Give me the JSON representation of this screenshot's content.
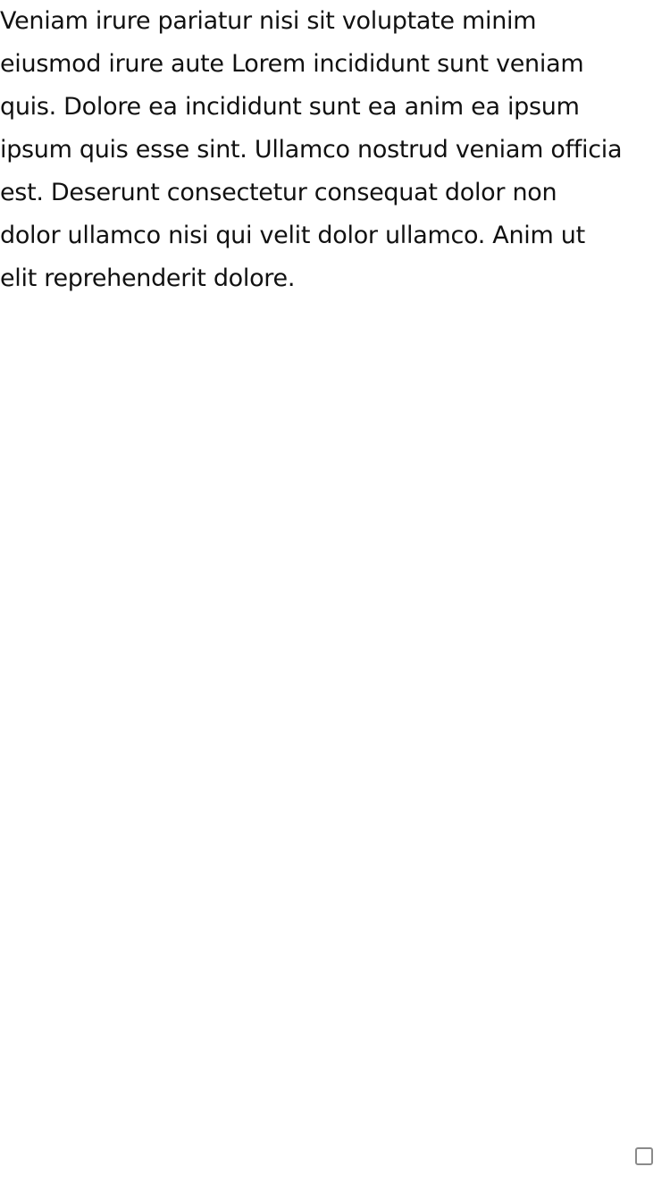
{
  "paragraph": {
    "lines": [
      "Veniam irure pariatur nisi sit voluptate minim",
      "eiusmod irure aute Lorem incididunt sunt veniam",
      "quis. Dolore ea incididunt sunt ea anim ea ipsum",
      "ipsum quis esse sint. Ullamco nostrud veniam officia",
      "est. Deserunt consectetur consequat dolor non",
      "dolor ullamco nisi qui velit dolor ullamco. Anim ut",
      "elit reprehenderit dolore."
    ]
  },
  "checkbox": {
    "checked": false
  }
}
